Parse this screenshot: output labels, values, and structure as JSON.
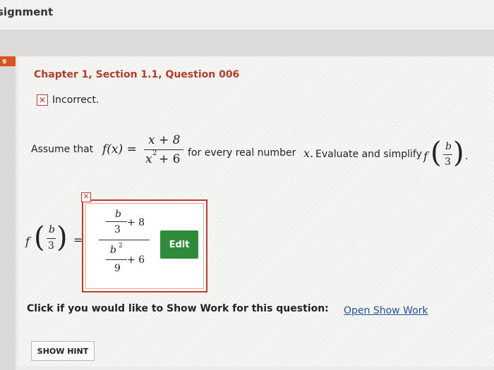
{
  "header": {
    "title": "signment",
    "rail_tab": "s"
  },
  "question": {
    "title": "Chapter 1, Section 1.1, Question 006",
    "status_text": "Incorrect.",
    "prompt_intro": "Assume that",
    "prompt_mid": "for every real number",
    "prompt_var": "x.",
    "prompt_end": "Evaluate and simplify",
    "fx_lhs": "f(x) =",
    "fx_num": "x + 8",
    "fx_den_x": "x",
    "fx_den_exp": "2",
    "fx_den_rest": "+ 6",
    "f_sym": "f",
    "arg_num": "b",
    "arg_den": "3",
    "trailing_dot": "."
  },
  "answer": {
    "f_sym": "f",
    "arg_num": "b",
    "arg_den": "3",
    "equals": "=",
    "top_b": "b",
    "top_3": "3",
    "top_plus": "+ 8",
    "bot_b": "b",
    "bot_exp": "2",
    "bot_9": "9",
    "bot_plus": "+ 6"
  },
  "buttons": {
    "edit": "Edit",
    "show_hint": "SHOW HINT"
  },
  "show_work": {
    "text": "Click if you would like to Show Work for this question:",
    "link": "Open Show Work"
  },
  "colors": {
    "accent": "#c23a2b",
    "title_red": "#b33d2a",
    "edit_green": "#2e8b3a",
    "link_blue": "#1f4f9e"
  },
  "icons": {
    "status": "x-mark-icon",
    "answer_status": "x-mark-icon"
  }
}
